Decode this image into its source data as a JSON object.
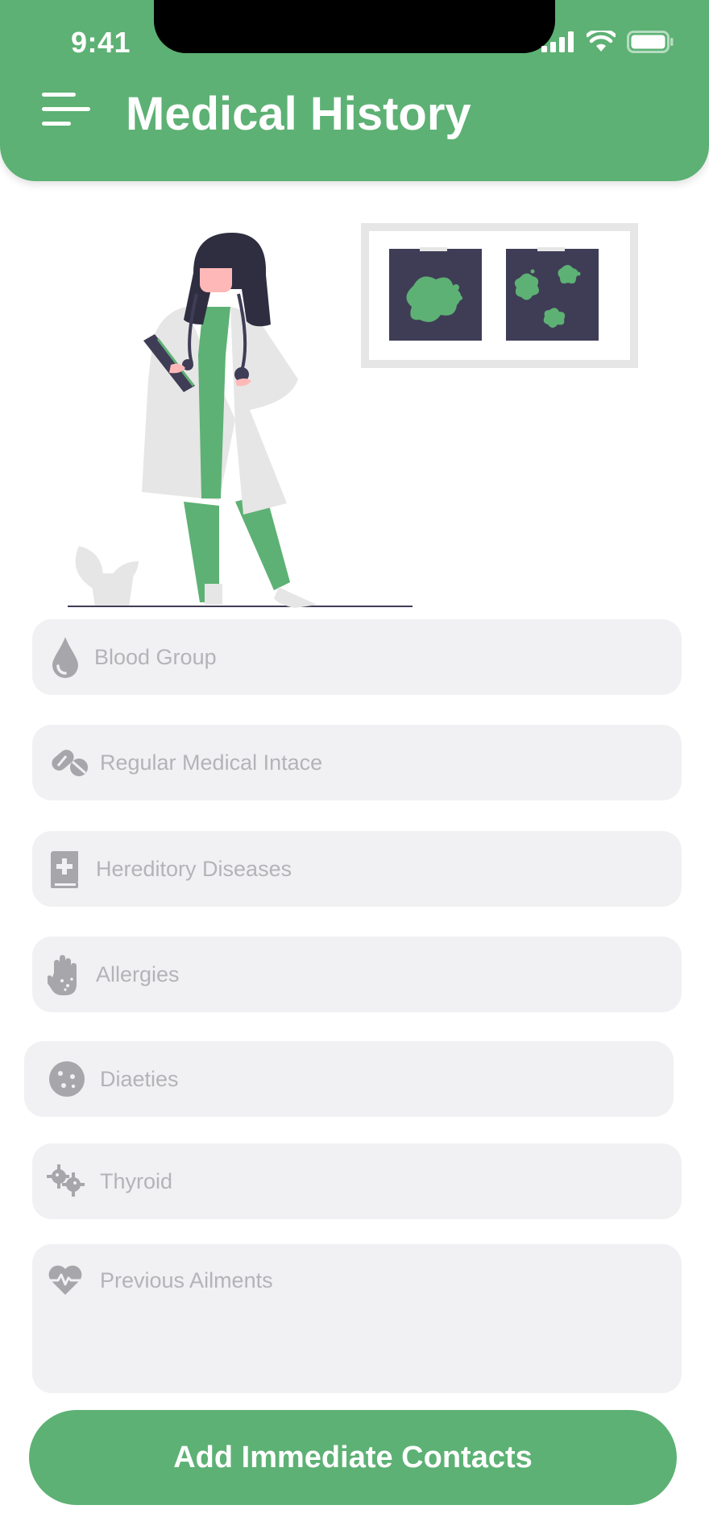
{
  "status_bar": {
    "time": "9:41"
  },
  "header": {
    "title": "Medical History"
  },
  "fields": [
    {
      "placeholder": "Blood Group",
      "icon": "blood-drop-icon"
    },
    {
      "placeholder": "Regular Medical Intace",
      "icon": "pills-icon"
    },
    {
      "placeholder": "Hereditory Diseases",
      "icon": "medical-book-icon"
    },
    {
      "placeholder": "Allergies",
      "icon": "allergy-hand-icon"
    },
    {
      "placeholder": "Diaeties",
      "icon": "cookie-icon"
    },
    {
      "placeholder": "Thyroid",
      "icon": "virus-icon"
    },
    {
      "placeholder": "Previous Ailments",
      "icon": "heartbeat-icon"
    }
  ],
  "cta": {
    "label": "Add Immediate Contacts"
  },
  "colors": {
    "primary": "#5db174",
    "field_bg": "#f1f1f3",
    "placeholder": "#b4b4b8",
    "icon": "#a7a7ab"
  }
}
